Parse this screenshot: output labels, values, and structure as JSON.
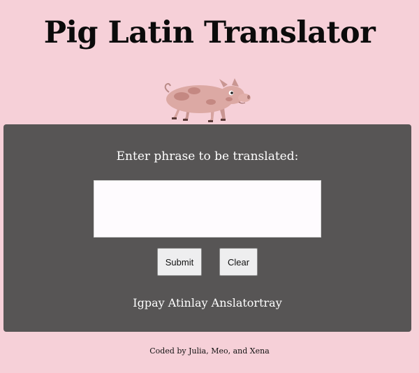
{
  "header": {
    "title": "Pig Latin Translator"
  },
  "logo": {
    "icon": "pig-icon"
  },
  "form": {
    "prompt_label": "Enter phrase to be translated:",
    "input_value": "",
    "input_placeholder": "",
    "submit_label": "Submit",
    "clear_label": "Clear"
  },
  "result": {
    "text": "Igpay Atinlay Anslatortray"
  },
  "footer": {
    "credit": "Coded by Julia, Meo, and Xena"
  },
  "colors": {
    "page_background": "#f6d0d8",
    "panel_background": "#575555",
    "input_background": "#fefbfe",
    "button_background": "#eeeeef"
  }
}
